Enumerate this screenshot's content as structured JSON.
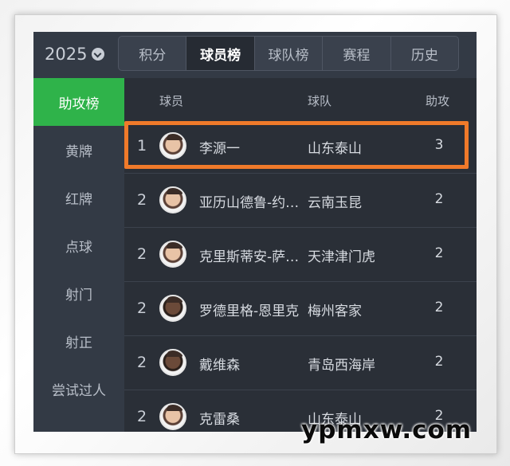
{
  "header": {
    "year": "2025",
    "tabs": [
      {
        "label": "积分"
      },
      {
        "label": "球员榜",
        "active": true
      },
      {
        "label": "球队榜"
      },
      {
        "label": "赛程"
      },
      {
        "label": "历史"
      }
    ]
  },
  "sidebar": {
    "items": [
      {
        "label": "助攻榜",
        "active": true
      },
      {
        "label": "黄牌"
      },
      {
        "label": "红牌"
      },
      {
        "label": "点球"
      },
      {
        "label": "射门"
      },
      {
        "label": "射正"
      },
      {
        "label": "尝试过人"
      }
    ]
  },
  "table": {
    "columns": {
      "player": "球员",
      "team": "球队",
      "stat": "助攻"
    },
    "rows": [
      {
        "rank": "1",
        "player": "李源一",
        "team": "山东泰山",
        "value": "3"
      },
      {
        "rank": "2",
        "player": "亚历山德鲁-约…",
        "team": "云南玉昆",
        "value": "2"
      },
      {
        "rank": "2",
        "player": "克里斯蒂安-萨…",
        "team": "天津津门虎",
        "value": "2"
      },
      {
        "rank": "2",
        "player": "罗德里格-恩里克",
        "team": "梅州客家",
        "value": "2"
      },
      {
        "rank": "2",
        "player": "戴维森",
        "team": "青岛西海岸",
        "value": "2"
      },
      {
        "rank": "2",
        "player": "克雷桑",
        "team": "山东泰山",
        "value": "2"
      }
    ]
  },
  "colors": {
    "accent_green": "#2fb34a",
    "highlight_orange": "#f07a2a",
    "background": "#2a2f37"
  },
  "watermark": "ypmxw.com"
}
